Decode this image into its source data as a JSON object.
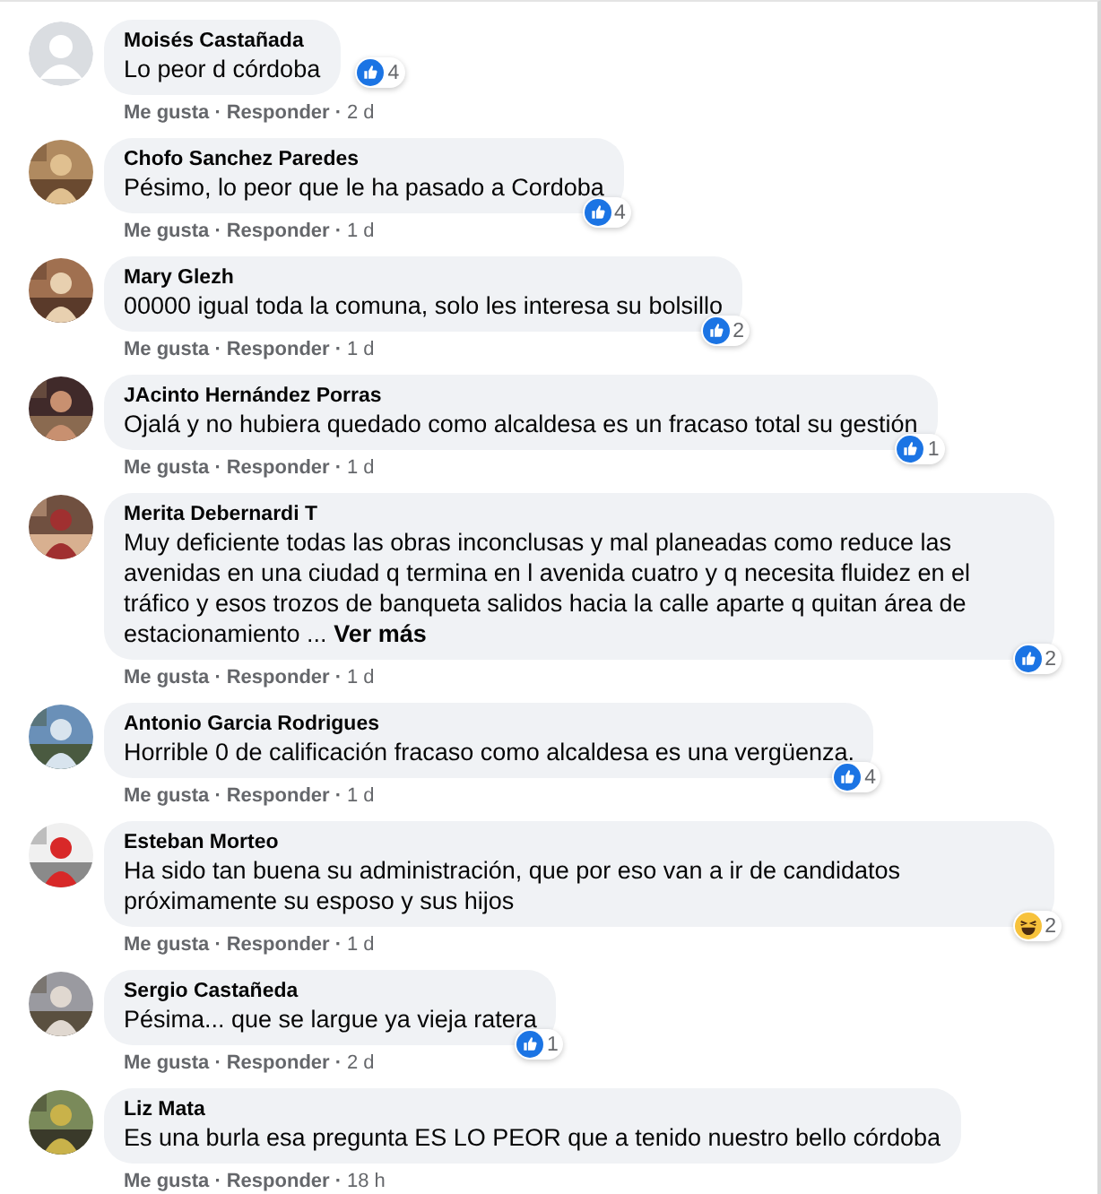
{
  "separator": "·",
  "comments": [
    {
      "author": "Moisés Castañada",
      "avatar": {
        "kind": "default"
      },
      "text": "Lo peor d córdoba",
      "reaction": {
        "kind": "like",
        "count": "4"
      },
      "actions": [
        "Me gusta",
        "Responder"
      ],
      "time": "2 d"
    },
    {
      "author": "Chofo Sanchez Paredes",
      "text": "Pésimo, lo peor que le ha pasado a Cordoba",
      "reaction": {
        "kind": "like",
        "count": "4"
      },
      "actions": [
        "Me gusta",
        "Responder"
      ],
      "time": "1 d"
    },
    {
      "author": "Mary Glezh",
      "text": "00000 igual toda la comuna, solo les interesa su bolsillo",
      "reaction": {
        "kind": "like",
        "count": "2"
      },
      "actions": [
        "Me gusta",
        "Responder"
      ],
      "time": "1 d"
    },
    {
      "author": "JAcinto Hernández Porras",
      "text": "Ojalá y no hubiera quedado como alcaldesa es un fracaso total su gestión",
      "reaction": {
        "kind": "like",
        "count": "1"
      },
      "actions": [
        "Me gusta",
        "Responder"
      ],
      "time": "1 d"
    },
    {
      "author": "Merita Debernardi T",
      "text": "Muy deficiente todas las obras inconclusas y mal planeadas como reduce las avenidas en una ciudad q termina en l avenida cuatro y q necesita fluidez en el tráfico y esos trozos de banqueta salidos hacia la calle aparte q quitan área de estacionamiento ...",
      "see_more": "Ver más",
      "reaction": {
        "kind": "like",
        "count": "2"
      },
      "actions": [
        "Me gusta",
        "Responder"
      ],
      "time": "1 d"
    },
    {
      "author": "Antonio Garcia Rodrigues",
      "text": "Horrible 0 de calificación fracaso como alcaldesa es una vergüenza.",
      "reaction": {
        "kind": "like",
        "count": "4"
      },
      "actions": [
        "Me gusta",
        "Responder"
      ],
      "time": "1 d"
    },
    {
      "author": "Esteban Morteo",
      "text": "Ha sido tan buena su administración, que por eso van a ir de candidatos próximamente su esposo y sus hijos",
      "reaction": {
        "kind": "haha",
        "count": "2"
      },
      "actions": [
        "Me gusta",
        "Responder"
      ],
      "time": "1 d"
    },
    {
      "author": "Sergio Castañeda",
      "text": "Pésima... que se largue ya vieja ratera",
      "reaction": {
        "kind": "like",
        "count": "1"
      },
      "actions": [
        "Me gusta",
        "Responder"
      ],
      "time": "2 d"
    },
    {
      "author": "Liz Mata",
      "text": "Es una burla esa pregunta ES LO PEOR que a tenido nuestro bello córdoba",
      "actions": [
        "Me gusta",
        "Responder"
      ],
      "time": "18 h"
    }
  ]
}
